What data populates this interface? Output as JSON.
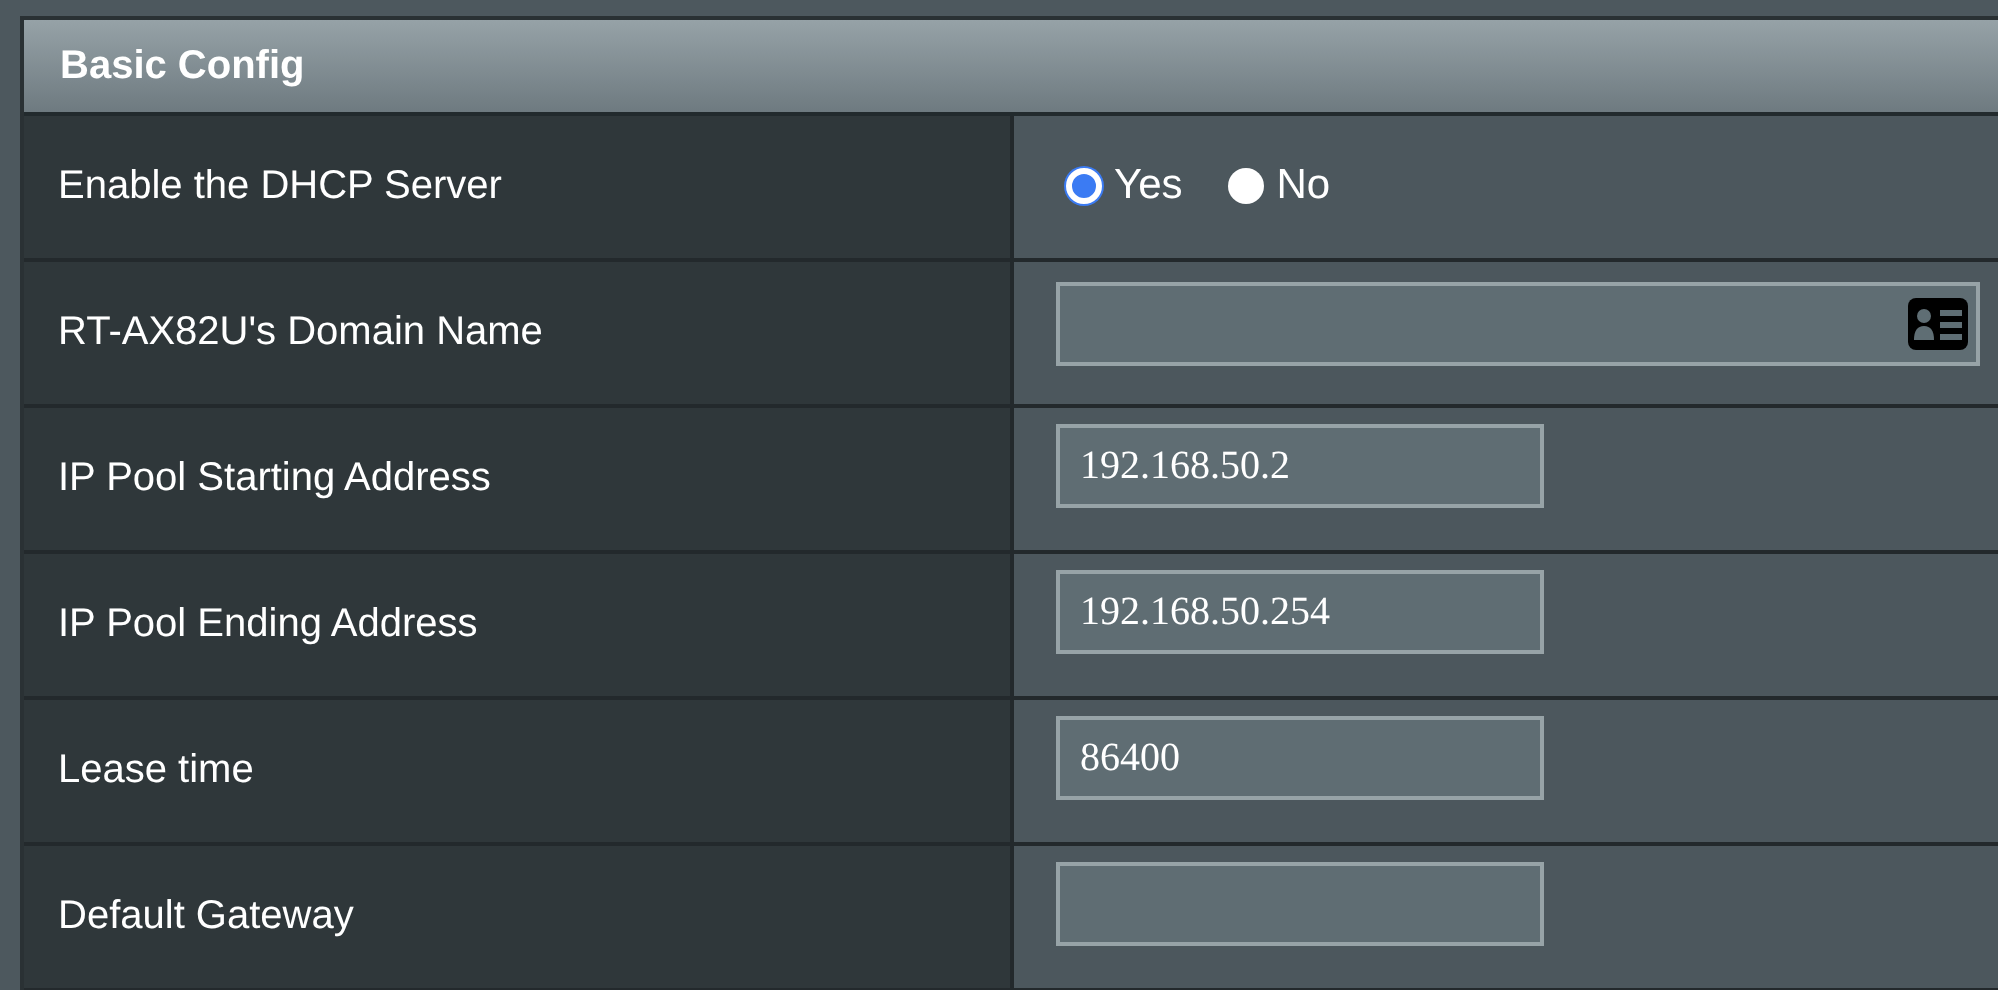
{
  "section": {
    "title": "Basic Config"
  },
  "rows": [
    {
      "label": "Enable the DHCP Server",
      "kind": "radio",
      "options": [
        {
          "label": "Yes",
          "selected": true
        },
        {
          "label": "No",
          "selected": false
        }
      ]
    },
    {
      "label": "RT-AX82U's Domain Name",
      "kind": "wide-field"
    },
    {
      "label": "IP Pool Starting Address",
      "kind": "field",
      "value": "192.168.50.2"
    },
    {
      "label": "IP Pool Ending Address",
      "kind": "field",
      "value": "192.168.50.254"
    },
    {
      "label": "Lease time",
      "kind": "field",
      "value": "86400"
    },
    {
      "label": "Default Gateway",
      "kind": "field"
    }
  ]
}
